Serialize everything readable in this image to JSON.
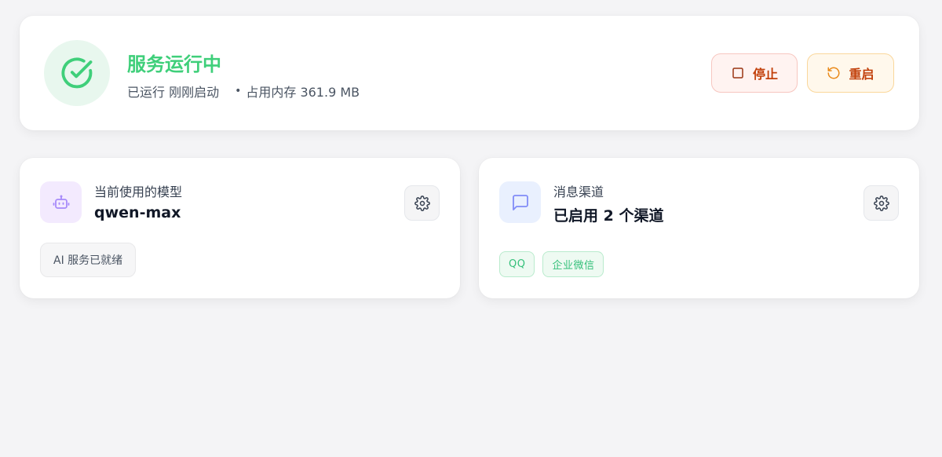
{
  "status": {
    "title": "服务运行中",
    "uptime": "已运行 刚刚启动",
    "memory": "占用内存 361.9 MB",
    "color": "#3fcf7a",
    "icon": "check-circle-icon"
  },
  "actions": {
    "stop_label": "停止",
    "restart_label": "重启"
  },
  "model_card": {
    "label": "当前使用的模型",
    "value": "qwen-max",
    "badge": "AI 服务已就绪",
    "icon": "robot-icon"
  },
  "channel_card": {
    "label": "消息渠道",
    "value": "已启用 2 个渠道",
    "tags": [
      "QQ",
      "企业微信"
    ],
    "icon": "message-square-icon"
  }
}
